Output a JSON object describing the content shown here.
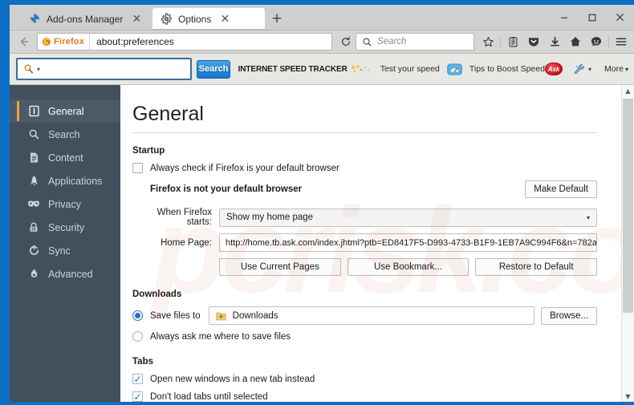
{
  "window": {
    "controls": {
      "minimize": "–",
      "maximize": "□",
      "close": "✕"
    }
  },
  "tabs": [
    {
      "label": "Add-ons Manager",
      "icon": "addons-puzzle-icon",
      "close": "✕",
      "active": false
    },
    {
      "label": "Options",
      "icon": "gear-icon",
      "close": "✕",
      "active": true
    }
  ],
  "newtab_label": "+",
  "navbar": {
    "back_icon": "back-arrow-icon",
    "identity_label": "Firefox",
    "url": "about:preferences",
    "reload_icon": "reload-icon",
    "search_placeholder": "Search",
    "icons": [
      {
        "name": "bookmark-star-icon",
        "glyph": "☆"
      },
      {
        "name": "reader-view-icon",
        "glyph": "Ὄb"
      },
      {
        "name": "pocket-icon",
        "glyph": "pocket"
      },
      {
        "name": "downloads-icon",
        "glyph": "⬇"
      },
      {
        "name": "home-icon",
        "glyph": "⌂"
      },
      {
        "name": "sync-account-icon",
        "glyph": "☺"
      },
      {
        "name": "menu-hamburger-icon",
        "glyph": "≡"
      }
    ]
  },
  "ext_toolbar": {
    "search_value": "",
    "search_caret": "▾",
    "search_button": "Search",
    "brand": "INTERNET SPEED TRACKER",
    "links": [
      {
        "label": "Test your speed"
      },
      {
        "label": "Tips to Boost Speed"
      }
    ],
    "ask_logo_text": "Ask",
    "tools_icon": "wrench-tools-icon",
    "more_label": "More",
    "more_caret": "▾"
  },
  "sidebar": {
    "items": [
      {
        "label": "General",
        "icon": "general-icon",
        "selected": true
      },
      {
        "label": "Search",
        "icon": "search-icon",
        "selected": false
      },
      {
        "label": "Content",
        "icon": "content-page-icon",
        "selected": false
      },
      {
        "label": "Applications",
        "icon": "rocket-icon",
        "selected": false
      },
      {
        "label": "Privacy",
        "icon": "mask-icon",
        "selected": false
      },
      {
        "label": "Security",
        "icon": "lock-icon",
        "selected": false
      },
      {
        "label": "Sync",
        "icon": "sync-icon",
        "selected": false
      },
      {
        "label": "Advanced",
        "icon": "gear-advanced-icon",
        "selected": false
      }
    ]
  },
  "main": {
    "title": "General",
    "startup": {
      "heading": "Startup",
      "default_browser_checkbox": {
        "label": "Always check if Firefox is your default browser",
        "checked": false
      },
      "status_text": "Firefox is not your default browser",
      "make_default_button": "Make Default",
      "when_starts_label": "When Firefox starts:",
      "when_starts_value": "Show my home page",
      "home_page_label": "Home Page:",
      "home_page_value": "http://home.tb.ask.com/index.jhtml?ptb=ED8417F5-D993-4733-B1F9-1EB7A9C994F6&n=782a…",
      "buttons": [
        "Use Current Pages",
        "Use Bookmark...",
        "Restore to Default"
      ]
    },
    "downloads": {
      "heading": "Downloads",
      "save_to_label": "Save files to",
      "save_to_selected": true,
      "folder_value": "Downloads",
      "folder_icon": "download-folder-icon",
      "browse_button": "Browse...",
      "always_ask_label": "Always ask me where to save files",
      "always_ask_selected": false
    },
    "tabs_section": {
      "heading": "Tabs",
      "options": [
        {
          "label": "Open new windows in a new tab instead",
          "checked": true
        },
        {
          "label": "Don't load tabs until selected",
          "checked": true
        }
      ]
    }
  },
  "scrollbar": {
    "up": "▲",
    "down": "▼"
  },
  "watermark": "pcrisk.com",
  "colors": {
    "window_border": "#0d6fc4",
    "sidebar_bg": "#424f5c",
    "sidebar_selected": "#4c5a68",
    "accent_orange": "#e8a33d",
    "accent_blue": "#1e74c8",
    "ask_red": "#cc0b18"
  }
}
